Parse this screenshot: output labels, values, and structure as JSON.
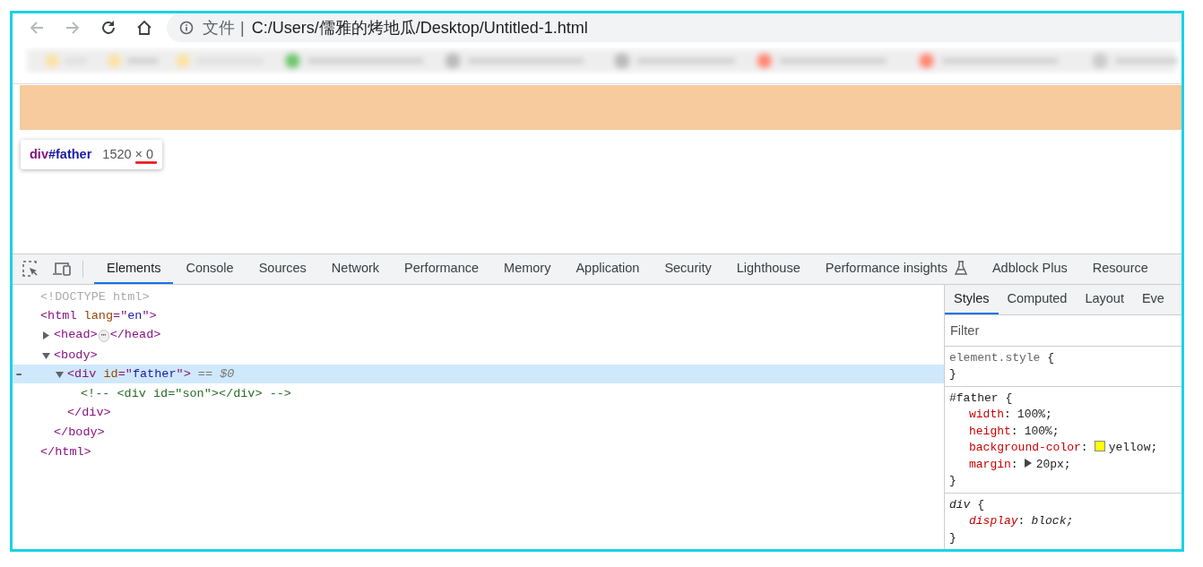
{
  "toolbar": {
    "back_disabled": true,
    "forward_disabled": true,
    "address": {
      "scheme_label": "文件",
      "separator": "|",
      "url": "C:/Users/儒雅的烤地瓜/Desktop/Untitled-1.html"
    }
  },
  "inspect_tooltip": {
    "tag": "div",
    "id": "#father",
    "size": "1520 × 0"
  },
  "devtools": {
    "tabs": [
      {
        "label": "Elements",
        "selected": true,
        "experimental": false
      },
      {
        "label": "Console",
        "selected": false,
        "experimental": false
      },
      {
        "label": "Sources",
        "selected": false,
        "experimental": false
      },
      {
        "label": "Network",
        "selected": false,
        "experimental": false
      },
      {
        "label": "Performance",
        "selected": false,
        "experimental": false
      },
      {
        "label": "Memory",
        "selected": false,
        "experimental": false
      },
      {
        "label": "Application",
        "selected": false,
        "experimental": false
      },
      {
        "label": "Security",
        "selected": false,
        "experimental": false
      },
      {
        "label": "Lighthouse",
        "selected": false,
        "experimental": false
      },
      {
        "label": "Performance insights",
        "selected": false,
        "experimental": true
      },
      {
        "label": "Adblock Plus",
        "selected": false,
        "experimental": false
      },
      {
        "label": "Resource",
        "selected": false,
        "experimental": false
      }
    ],
    "dom_tree": [
      {
        "tokens": [
          {
            "kind": "doctype",
            "text": "<!DOCTYPE html>"
          }
        ],
        "selected": false
      },
      {
        "tokens": [
          {
            "kind": "tag",
            "text": "<html"
          },
          {
            "kind": "attr",
            "text": " lang"
          },
          {
            "kind": "tag",
            "text": "=\""
          },
          {
            "kind": "value",
            "text": "en"
          },
          {
            "kind": "tag",
            "text": "\">"
          }
        ],
        "selected": false,
        "close": [
          {
            "kind": "tag",
            "text": "</html>"
          }
        ],
        "children": [
          {
            "tokens": [
              {
                "kind": "tag",
                "text": "<head>"
              },
              {
                "kind": "ellipsis",
                "text": "⋯"
              },
              {
                "kind": "tag",
                "text": "</head>"
              }
            ],
            "expanded": false,
            "selected": false
          },
          {
            "tokens": [
              {
                "kind": "tag",
                "text": "<body>"
              }
            ],
            "expanded": true,
            "selected": false,
            "close": [
              {
                "kind": "tag",
                "text": "</body>"
              }
            ],
            "children": [
              {
                "tokens": [
                  {
                    "kind": "tag",
                    "text": "<div"
                  },
                  {
                    "kind": "attr",
                    "text": " id"
                  },
                  {
                    "kind": "tag",
                    "text": "=\""
                  },
                  {
                    "kind": "value",
                    "text": "father"
                  },
                  {
                    "kind": "tag",
                    "text": "\">"
                  },
                  {
                    "kind": "marker",
                    "text": " == $0"
                  }
                ],
                "expanded": true,
                "selected": true,
                "gutter": "•••",
                "close": [
                  {
                    "kind": "tag",
                    "text": "</div>"
                  }
                ],
                "children": [
                  {
                    "tokens": [
                      {
                        "kind": "comment",
                        "text": "<!-- <div id=\"son\"></div> -->"
                      }
                    ],
                    "selected": false
                  }
                ]
              }
            ]
          }
        ]
      }
    ],
    "sidebar": {
      "tabs": [
        {
          "label": "Styles",
          "selected": true
        },
        {
          "label": "Computed",
          "selected": false
        },
        {
          "label": "Layout",
          "selected": false
        },
        {
          "label": "Eve",
          "selected": false
        }
      ],
      "filter": {
        "placeholder": "Filter"
      },
      "rules": [
        {
          "kind": "inline",
          "selector": "element.style",
          "open": "{",
          "close": "}"
        },
        {
          "kind": "author",
          "selector": "#father",
          "open": "{",
          "close": "}",
          "declarations": [
            {
              "property": "width",
              "separator": ":",
              "value": "100%;"
            },
            {
              "property": "height",
              "separator": ":",
              "value": "100%;"
            },
            {
              "property": "background-color",
              "separator": ":",
              "value": "yellow;",
              "color": "#ffff00"
            },
            {
              "property": "margin",
              "separator": ":",
              "value": "20px;",
              "expandable": true
            }
          ]
        },
        {
          "kind": "user-agent",
          "selector": "div",
          "open": "{",
          "close": "}",
          "declarations": [
            {
              "property": "display",
              "separator": ":",
              "value": "block;"
            }
          ]
        }
      ]
    }
  }
}
